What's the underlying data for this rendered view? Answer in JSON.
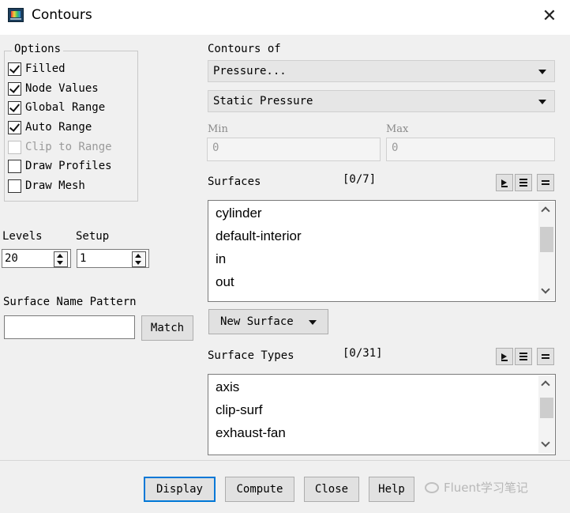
{
  "window": {
    "title": "Contours"
  },
  "options": {
    "legend": "Options",
    "items": [
      {
        "label": "Filled",
        "checked": true,
        "enabled": true
      },
      {
        "label": "Node Values",
        "checked": true,
        "enabled": true
      },
      {
        "label": "Global Range",
        "checked": true,
        "enabled": true
      },
      {
        "label": "Auto Range",
        "checked": true,
        "enabled": true
      },
      {
        "label": "Clip to Range",
        "checked": false,
        "enabled": false
      },
      {
        "label": "Draw Profiles",
        "checked": false,
        "enabled": true
      },
      {
        "label": "Draw Mesh",
        "checked": false,
        "enabled": true
      }
    ]
  },
  "levels": {
    "label": "Levels",
    "value": "20"
  },
  "setup": {
    "label": "Setup",
    "value": "1"
  },
  "surface_name_pattern": {
    "label": "Surface Name Pattern",
    "value": "",
    "match_label": "Match"
  },
  "contours_of": {
    "label": "Contours of",
    "primary": "Pressure...",
    "secondary": "Static Pressure"
  },
  "min": {
    "label": "Min",
    "value": "0"
  },
  "max": {
    "label": "Max",
    "value": "0"
  },
  "surfaces": {
    "label": "Surfaces",
    "count": "[0/7]",
    "items": [
      "cylinder",
      "default-interior",
      "in",
      "out"
    ]
  },
  "new_surface": {
    "label": "New Surface"
  },
  "surface_types": {
    "label": "Surface Types",
    "count": "[0/31]",
    "items": [
      "axis",
      "clip-surf",
      "exhaust-fan"
    ]
  },
  "buttons": {
    "display": "Display",
    "compute": "Compute",
    "close": "Close",
    "help": "Help"
  },
  "watermark": {
    "text": "Fluent学习笔记"
  },
  "colors": {
    "accent_border": "#0078d7"
  }
}
